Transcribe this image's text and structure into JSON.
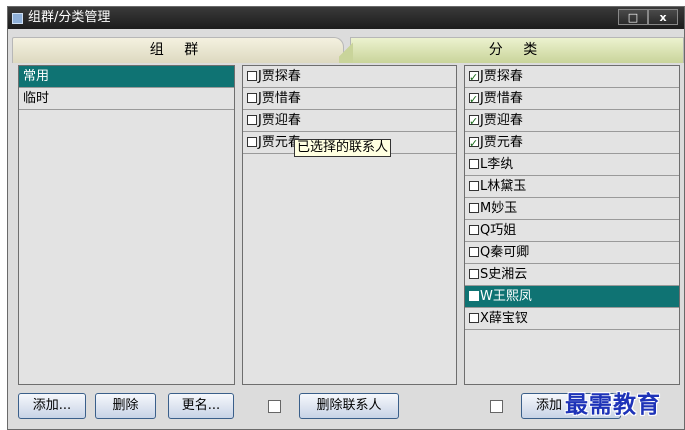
{
  "window": {
    "title": "组群/分类管理",
    "restore_label": "□",
    "close_label": "x"
  },
  "tabs": {
    "groups": "组 群",
    "categories": "分 类"
  },
  "groups": [
    {
      "label": "常用",
      "selected": true
    },
    {
      "label": "临时",
      "selected": false
    }
  ],
  "members": [
    {
      "label": "J贾探春",
      "checked": false
    },
    {
      "label": "J贾惜春",
      "checked": false
    },
    {
      "label": "J贾迎春",
      "checked": false
    },
    {
      "label": "J贾元春",
      "checked": false
    }
  ],
  "tooltip": "已选择的联系人",
  "contacts": [
    {
      "label": "J贾探春",
      "checked": true,
      "selected": false
    },
    {
      "label": "J贾惜春",
      "checked": true,
      "selected": false
    },
    {
      "label": "J贾迎春",
      "checked": true,
      "selected": false
    },
    {
      "label": "J贾元春",
      "checked": true,
      "selected": false
    },
    {
      "label": "L李纨",
      "checked": false,
      "selected": false
    },
    {
      "label": "L林黛玉",
      "checked": false,
      "selected": false
    },
    {
      "label": "M妙玉",
      "checked": false,
      "selected": false
    },
    {
      "label": "Q巧姐",
      "checked": false,
      "selected": false
    },
    {
      "label": "Q秦可卿",
      "checked": false,
      "selected": false
    },
    {
      "label": "S史湘云",
      "checked": false,
      "selected": false
    },
    {
      "label": "W王熙凤",
      "checked": false,
      "selected": true
    },
    {
      "label": "X薛宝钗",
      "checked": false,
      "selected": false
    }
  ],
  "buttons": {
    "add": "添加...",
    "delete": "删除",
    "rename": "更名...",
    "remove_contact": "删除联系人",
    "add_contact": "添加"
  },
  "watermark": "最需教育",
  "colors": {
    "selection": "#0f7373",
    "button_border": "#3a5f8a"
  }
}
